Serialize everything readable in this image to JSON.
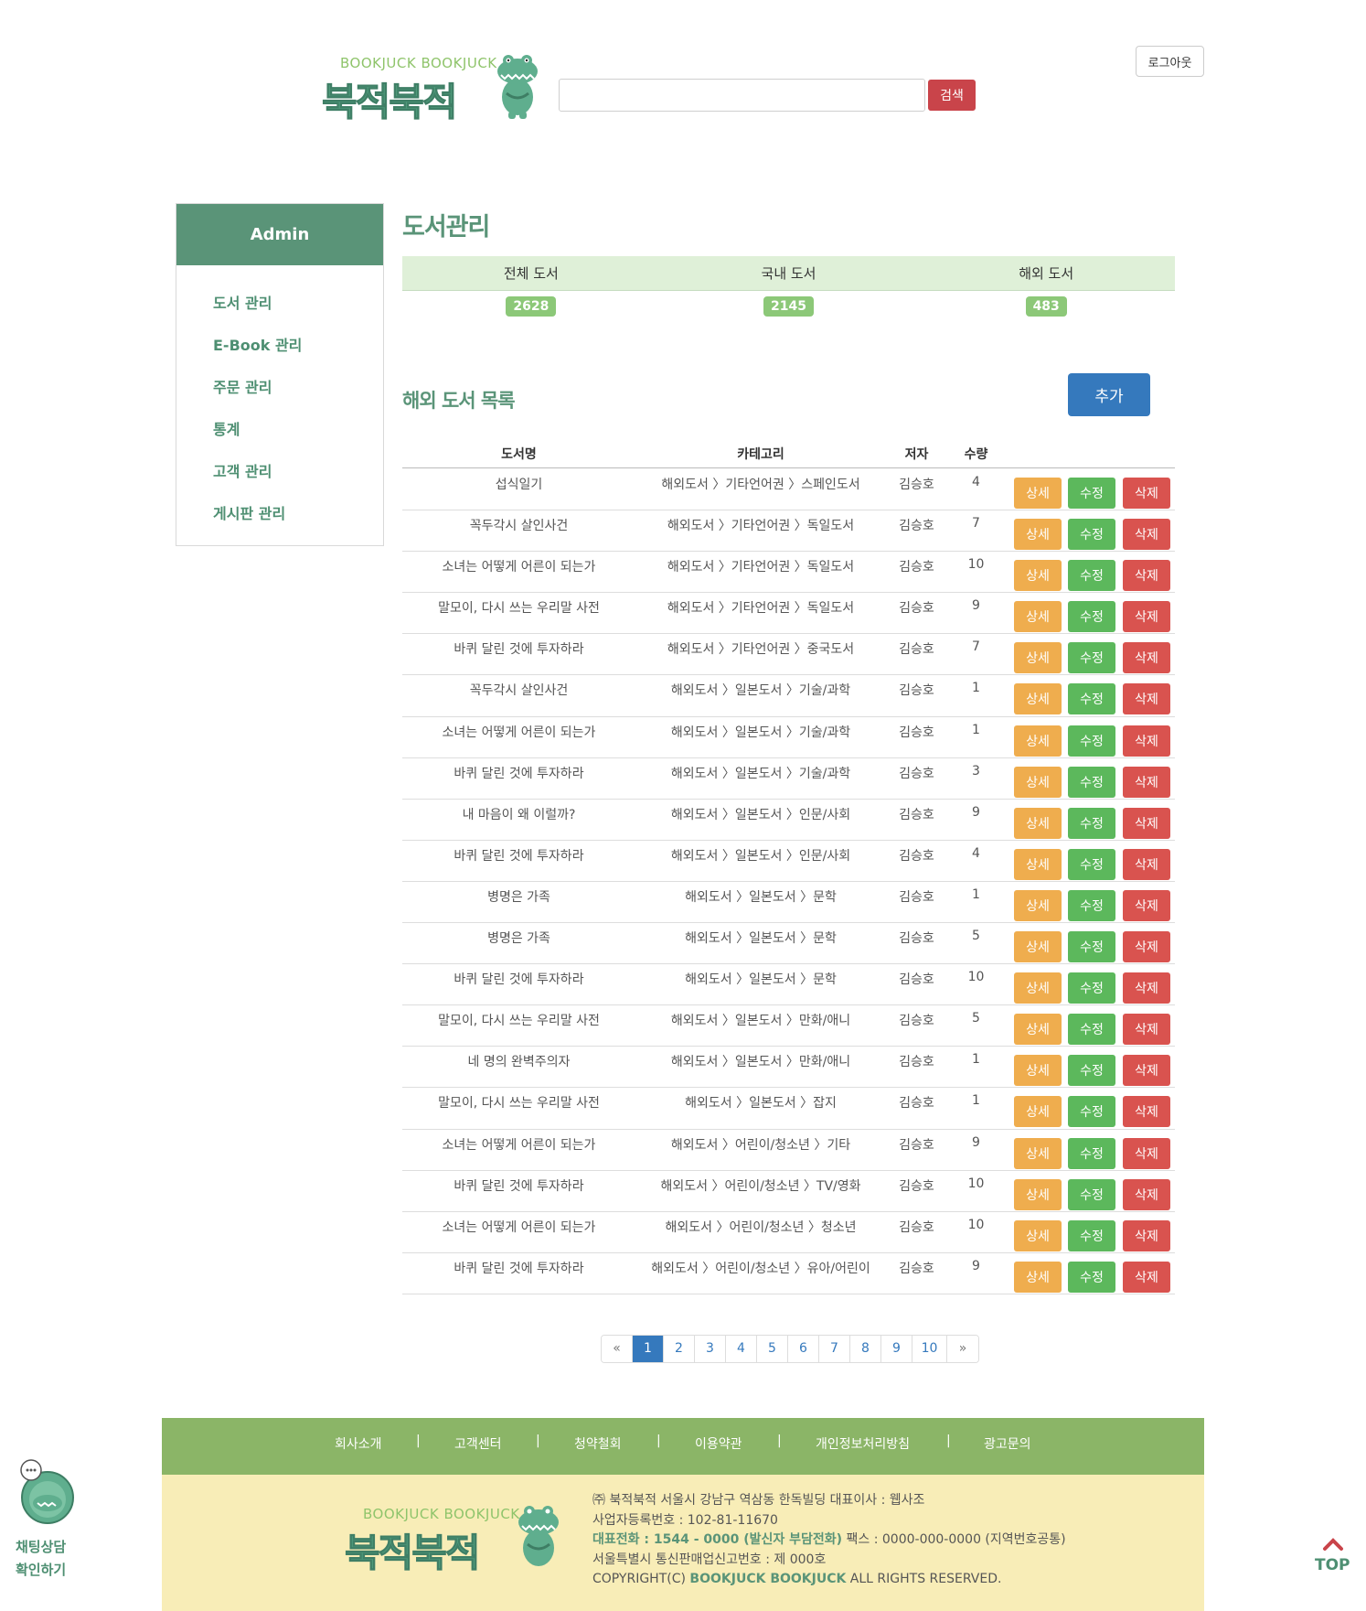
{
  "header": {
    "logo_small": "BOOKJUCK BOOKJUCK",
    "logo_big": "북적북적",
    "search_button": "검색",
    "search_value": "",
    "logout_button": "로그아웃"
  },
  "sidebar": {
    "title": "Admin",
    "items": [
      "도서 관리",
      "E-Book 관리",
      "주문 관리",
      "통계",
      "고객 관리",
      "게시판 관리"
    ]
  },
  "main": {
    "page_title": "도서관리",
    "stats": {
      "labels": [
        "전체 도서",
        "국내 도서",
        "해외 도서"
      ],
      "values": [
        "2628",
        "2145",
        "483"
      ]
    },
    "section_title": "해외 도서 목록",
    "add_button": "추가",
    "table": {
      "headers": [
        "도서명",
        "카테고리",
        "저자",
        "수량"
      ],
      "actions": {
        "detail": "상세",
        "edit": "수정",
        "delete": "삭제"
      },
      "rows": [
        {
          "title": "섭식일기",
          "category": "해외도서 〉기타언어권 〉스페인도서",
          "author": "김승호",
          "qty": "4"
        },
        {
          "title": "꼭두각시 살인사건",
          "category": "해외도서 〉기타언어권 〉독일도서",
          "author": "김승호",
          "qty": "7"
        },
        {
          "title": "소녀는 어떻게 어른이 되는가",
          "category": "해외도서 〉기타언어권 〉독일도서",
          "author": "김승호",
          "qty": "10"
        },
        {
          "title": "말모이, 다시 쓰는 우리말 사전",
          "category": "해외도서 〉기타언어권 〉독일도서",
          "author": "김승호",
          "qty": "9"
        },
        {
          "title": "바퀴 달린 것에 투자하라",
          "category": "해외도서 〉기타언어권 〉중국도서",
          "author": "김승호",
          "qty": "7"
        },
        {
          "title": "꼭두각시 살인사건",
          "category": "해외도서 〉일본도서 〉기술/과학",
          "author": "김승호",
          "qty": "1"
        },
        {
          "title": "소녀는 어떻게 어른이 되는가",
          "category": "해외도서 〉일본도서 〉기술/과학",
          "author": "김승호",
          "qty": "1"
        },
        {
          "title": "바퀴 달린 것에 투자하라",
          "category": "해외도서 〉일본도서 〉기술/과학",
          "author": "김승호",
          "qty": "3"
        },
        {
          "title": "내 마음이 왜 이럴까?",
          "category": "해외도서 〉일본도서 〉인문/사회",
          "author": "김승호",
          "qty": "9"
        },
        {
          "title": "바퀴 달린 것에 투자하라",
          "category": "해외도서 〉일본도서 〉인문/사회",
          "author": "김승호",
          "qty": "4"
        },
        {
          "title": "병명은 가족",
          "category": "해외도서 〉일본도서 〉문학",
          "author": "김승호",
          "qty": "1"
        },
        {
          "title": "병명은 가족",
          "category": "해외도서 〉일본도서 〉문학",
          "author": "김승호",
          "qty": "5"
        },
        {
          "title": "바퀴 달린 것에 투자하라",
          "category": "해외도서 〉일본도서 〉문학",
          "author": "김승호",
          "qty": "10"
        },
        {
          "title": "말모이, 다시 쓰는 우리말 사전",
          "category": "해외도서 〉일본도서 〉만화/애니",
          "author": "김승호",
          "qty": "5"
        },
        {
          "title": "네 명의 완벽주의자",
          "category": "해외도서 〉일본도서 〉만화/애니",
          "author": "김승호",
          "qty": "1"
        },
        {
          "title": "말모이, 다시 쓰는 우리말 사전",
          "category": "해외도서 〉일본도서 〉잡지",
          "author": "김승호",
          "qty": "1"
        },
        {
          "title": "소녀는 어떻게 어른이 되는가",
          "category": "해외도서 〉어린이/청소년 〉기타",
          "author": "김승호",
          "qty": "9"
        },
        {
          "title": "바퀴 달린 것에 투자하라",
          "category": "해외도서 〉어린이/청소년 〉TV/영화",
          "author": "김승호",
          "qty": "10"
        },
        {
          "title": "소녀는 어떻게 어른이 되는가",
          "category": "해외도서 〉어린이/청소년 〉청소년",
          "author": "김승호",
          "qty": "10"
        },
        {
          "title": "바퀴 달린 것에 투자하라",
          "category": "해외도서 〉어린이/청소년 〉유아/어린이",
          "author": "김승호",
          "qty": "9"
        }
      ]
    },
    "pagination": {
      "prev": "«",
      "pages": [
        "1",
        "2",
        "3",
        "4",
        "5",
        "6",
        "7",
        "8",
        "9",
        "10"
      ],
      "next": "»",
      "current": "1"
    }
  },
  "footer": {
    "nav": [
      "회사소개",
      "고객센터",
      "청약철회",
      "이용약관",
      "개인정보처리방침",
      "광고문의"
    ],
    "separator": "|",
    "logo_small": "BOOKJUCK BOOKJUCK",
    "logo_big": "북적북적",
    "info_line1": "㈜ 북적북적   서울시 강남구 역삼동 한독빌딩   대표이사 : 웹사조",
    "info_line2": "사업자등록번호 : 102-81-11670",
    "info_line3_hl": "대표전화 : 1544 - 0000 (발신자 부담전화)",
    "info_line3_rest": "   팩스 : 0000-000-0000 (지역번호공통)",
    "info_line4": "서울특별시 통신판매업신고번호 : 제 000호",
    "info_line5_pre": "COPYRIGHT(C) ",
    "info_line5_hl": "BOOKJUCK BOOKJUCK",
    "info_line5_post": " ALL RIGHTS RESERVED."
  },
  "floating": {
    "chat_line1": "채팅상담",
    "chat_line2": "확인하기",
    "top_label": "TOP"
  },
  "colors": {
    "brand_green": "#5a9478",
    "light_green": "#8cc878",
    "footer_nav": "#8bb567",
    "footer_body": "#f8edb7",
    "detail_btn": "#efad4e",
    "edit_btn": "#5cb85c",
    "delete_btn": "#d9534f",
    "primary_btn": "#3579bd",
    "search_btn": "#c9444a"
  }
}
